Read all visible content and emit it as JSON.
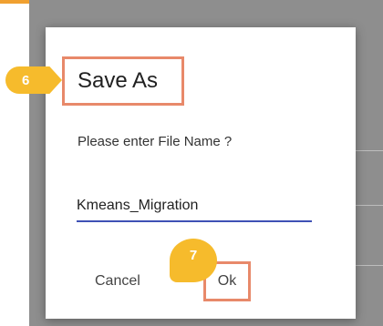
{
  "dialog": {
    "title": "Save As",
    "prompt": "Please enter File Name ?",
    "file_name_value": "Kmeans_Migration",
    "cancel_label": "Cancel",
    "ok_label": "Ok"
  },
  "step_markers": {
    "title_step": "6",
    "ok_step": "7"
  },
  "colors": {
    "accent_bar": "#f0a030",
    "highlight_border": "#e8896a",
    "step_marker": "#f6bb2c",
    "input_underline": "#3f51b5",
    "overlay": "#8e8e8e"
  }
}
